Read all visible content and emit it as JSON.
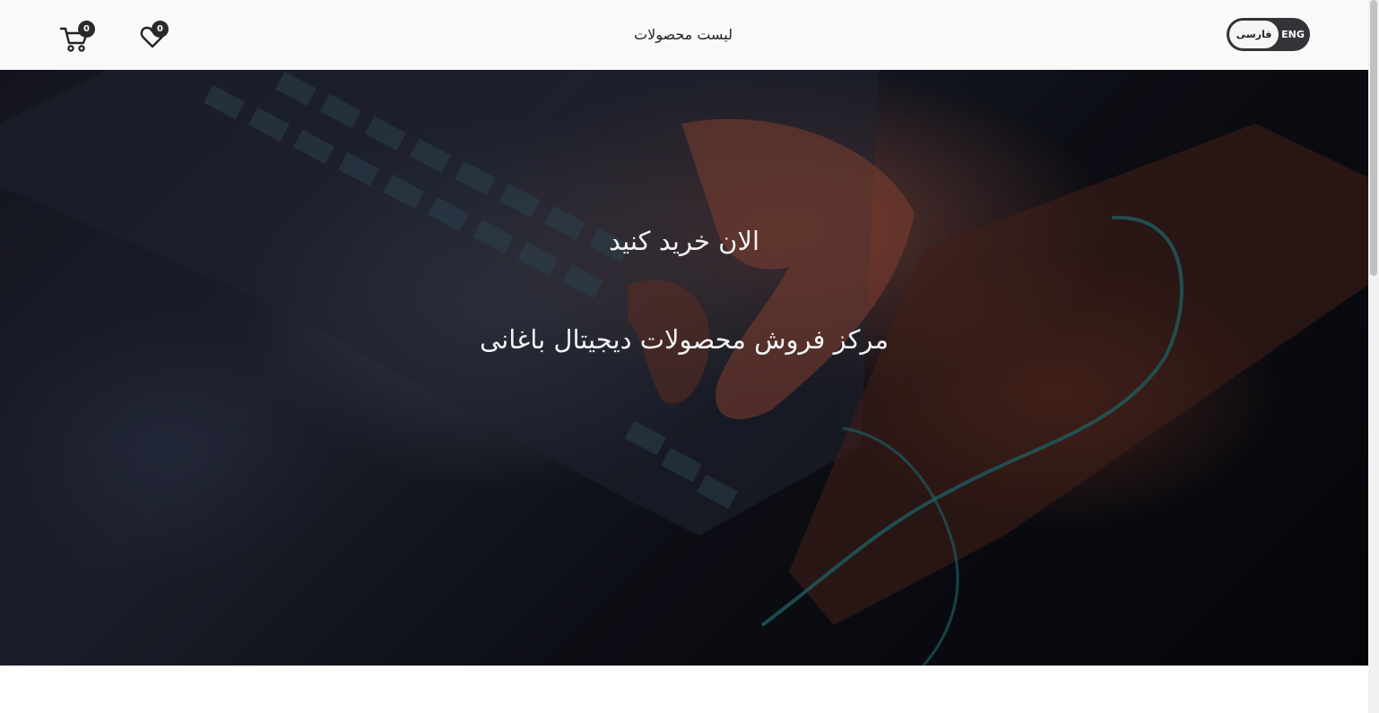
{
  "header": {
    "nav_link": "لیست محصولات",
    "cart_count": "0",
    "wishlist_count": "0",
    "cart_icon": "cart-icon",
    "wishlist_icon": "heart-icon",
    "language": {
      "active": "فارسی",
      "other": "ENG"
    }
  },
  "hero": {
    "title": "الان خرید کنید",
    "subtitle": "مرکز فروش محصولات دیجیتال باغانی"
  },
  "colors": {
    "header_bg": "#f9f9f9",
    "toggle_bg": "#333338",
    "badge_bg": "#2a2a2a",
    "hero_text": "#f2f2f2"
  }
}
